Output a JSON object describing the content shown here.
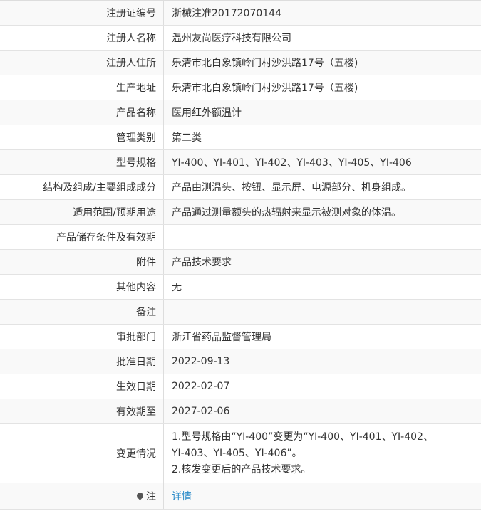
{
  "rows": [
    {
      "label": "注册证编号",
      "value": "浙械注准20172070144"
    },
    {
      "label": "注册人名称",
      "value": "温州友尚医疗科技有限公司"
    },
    {
      "label": "注册人住所",
      "value": "乐清市北白象镇岭门村沙洪路17号（五楼)"
    },
    {
      "label": "生产地址",
      "value": "乐清市北白象镇岭门村沙洪路17号（五楼)"
    },
    {
      "label": "产品名称",
      "value": "医用红外额温计"
    },
    {
      "label": "管理类别",
      "value": "第二类"
    },
    {
      "label": "型号规格",
      "value": "YI-400、YI-401、YI-402、YI-403、YI-405、YI-406"
    },
    {
      "label": "结构及组成/主要组成成分",
      "value": "产品由测温头、按钮、显示屏、电源部分、机身组成。"
    },
    {
      "label": "适用范围/预期用途",
      "value": "产品通过测量额头的热辐射来显示被测对象的体温。"
    },
    {
      "label": "产品储存条件及有效期",
      "value": ""
    },
    {
      "label": "附件",
      "value": "产品技术要求"
    },
    {
      "label": "其他内容",
      "value": "无"
    },
    {
      "label": "备注",
      "value": ""
    },
    {
      "label": "审批部门",
      "value": "浙江省药品监督管理局"
    },
    {
      "label": "批准日期",
      "value": "2022-09-13"
    },
    {
      "label": "生效日期",
      "value": "2022-02-07"
    },
    {
      "label": "有效期至",
      "value": "2027-02-06"
    }
  ],
  "change": {
    "label": "变更情况",
    "lines": [
      "1.型号规格由“YI-400”变更为“YI-400、YI-401、YI-402、",
      "YI-403、YI-405、YI-406”。",
      "2.核发变更后的产品技术要求。"
    ]
  },
  "note": {
    "label": "注",
    "icon": "pin-icon",
    "link_text": "详情",
    "link_color": "#2a8bc9"
  }
}
